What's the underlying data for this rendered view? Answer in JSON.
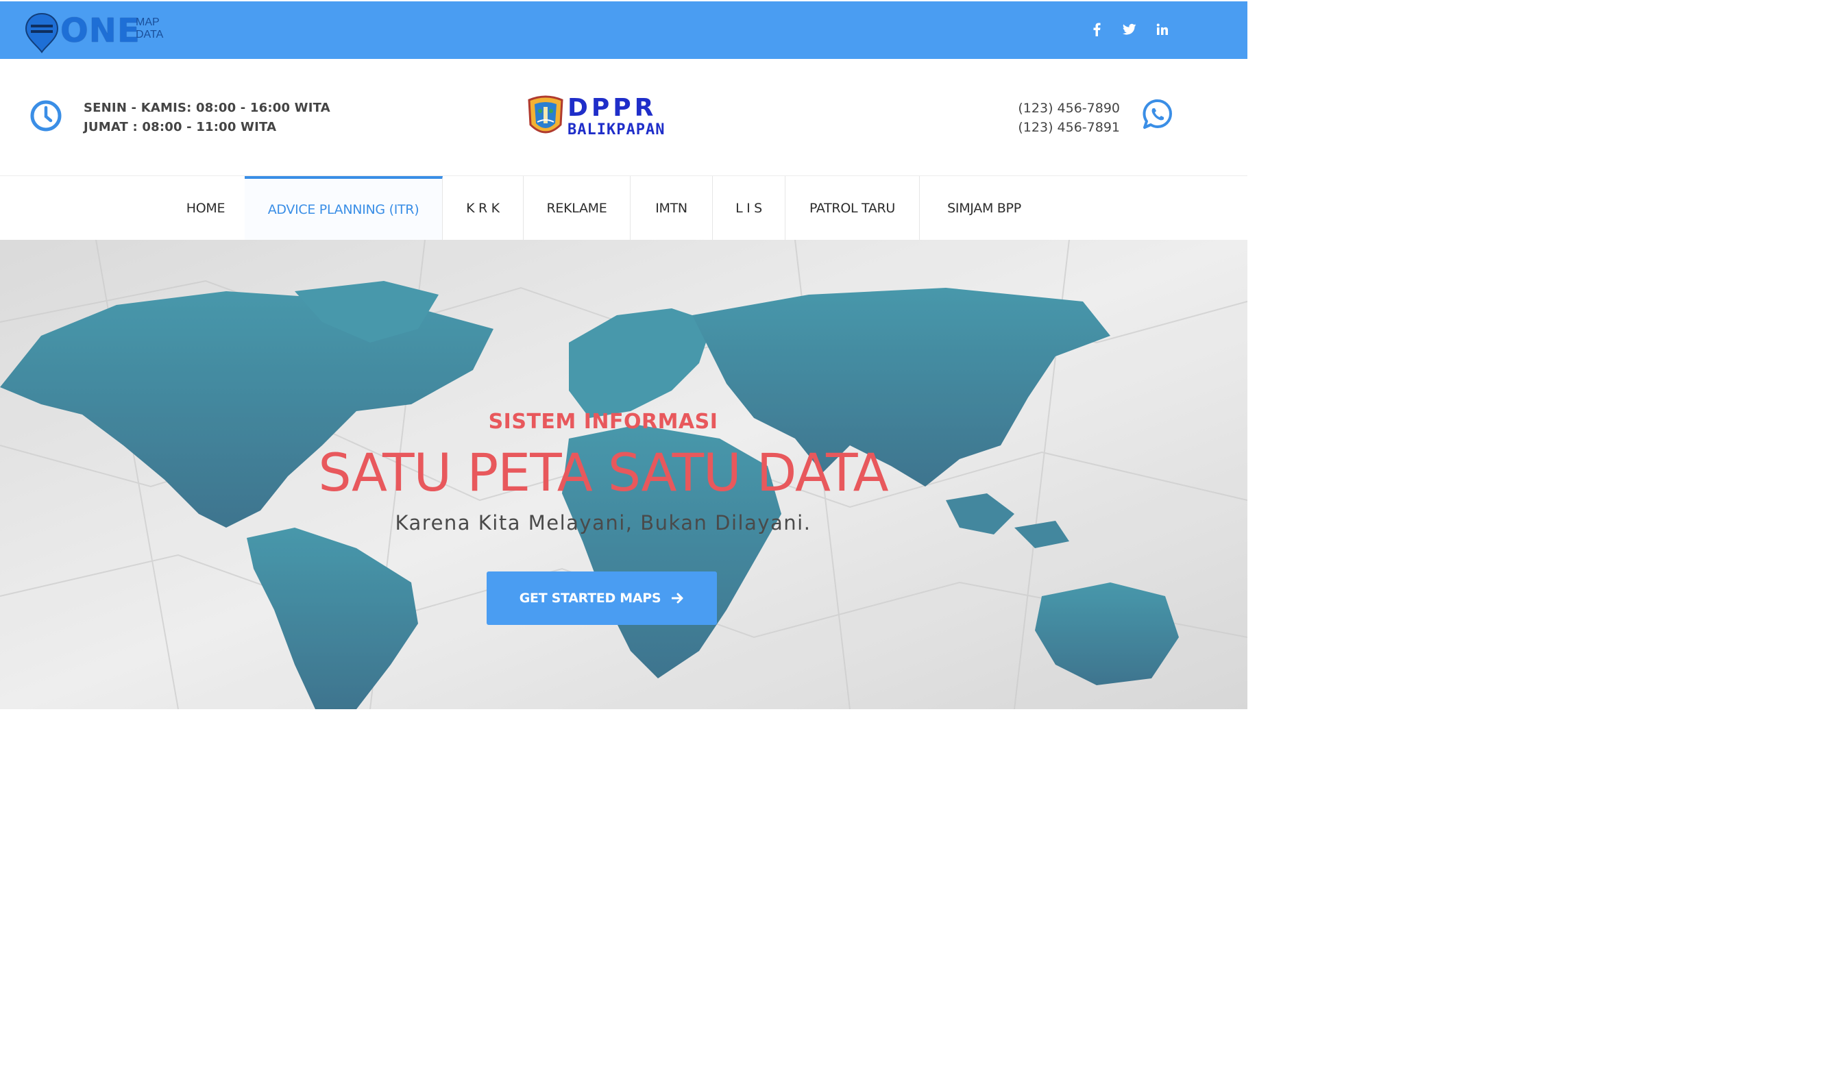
{
  "topbar": {
    "logo_word": "ONE",
    "logo_small_1": "MAP",
    "logo_small_2": "DATA",
    "bg_color": "#4a9df2",
    "social": [
      {
        "name": "facebook-icon",
        "glyph": "f"
      },
      {
        "name": "twitter-icon",
        "glyph": "t"
      },
      {
        "name": "linkedin-icon",
        "glyph": "in"
      }
    ]
  },
  "info": {
    "hours_line_1": "SENIN - KAMIS: 08:00 - 16:00 WITA",
    "hours_line_2": "JUMAT : 08:00 - 11:00 WITA",
    "org_title": "DPPR",
    "org_subtitle": "BALIKPAPAN",
    "phone_1": "(123) 456-7890",
    "phone_2": "(123) 456-7891"
  },
  "nav": {
    "items": [
      {
        "label": "HOME",
        "active": false
      },
      {
        "label": "ADVICE PLANNING (ITR)",
        "active": true
      },
      {
        "label": "K R K",
        "active": false
      },
      {
        "label": "REKLAME",
        "active": false
      },
      {
        "label": "IMTN",
        "active": false
      },
      {
        "label": "L I S",
        "active": false
      },
      {
        "label": "PATROL TARU",
        "active": false
      },
      {
        "label": "SIMJAM BPP",
        "active": false
      }
    ],
    "active_color": "#3a8ee6"
  },
  "hero": {
    "kicker": "SISTEM INFORMASI",
    "title": "SATU PETA SATU DATA",
    "subtitle": "Karena Kita Melayani, Bukan Dilayani.",
    "button_label": "GET STARTED MAPS",
    "accent_color": "#e8585c",
    "map_color": "#2f7f94"
  }
}
